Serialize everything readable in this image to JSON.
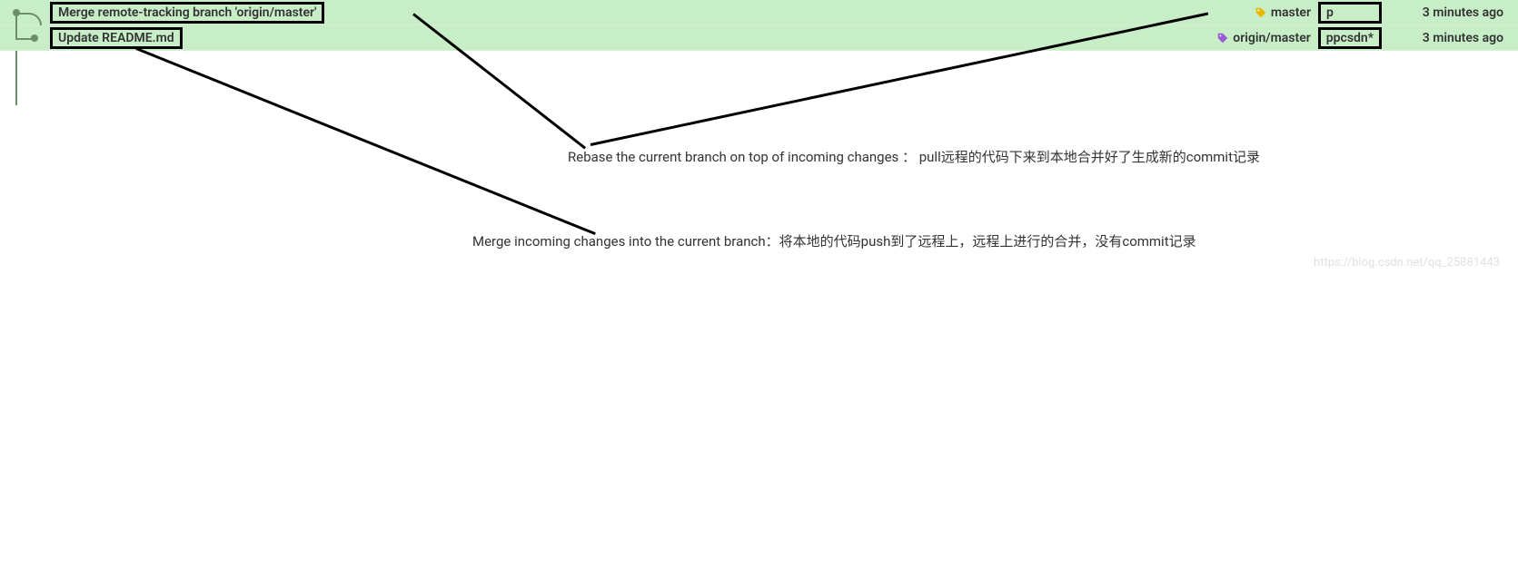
{
  "commits": [
    {
      "message": "Merge remote-tracking branch 'origin/master'",
      "branch_label": "master",
      "author": "p",
      "time": "3 minutes ago",
      "tag_color": "yellow"
    },
    {
      "message": "Update README.md",
      "branch_label": "origin/master",
      "author": "ppcsdn*",
      "time": "3 minutes ago",
      "tag_color": "purple"
    }
  ],
  "annotations": {
    "rebase": "Rebase the current branch on top of incoming changes ： pull远程的代码下来到本地合并好了生成新的commit记录",
    "merge": "Merge incoming changes into the current branch：将本地的代码push到了远程上，远程上进行的合并，没有commit记录"
  },
  "watermark": "https://blog.csdn.net/qq_25881443"
}
